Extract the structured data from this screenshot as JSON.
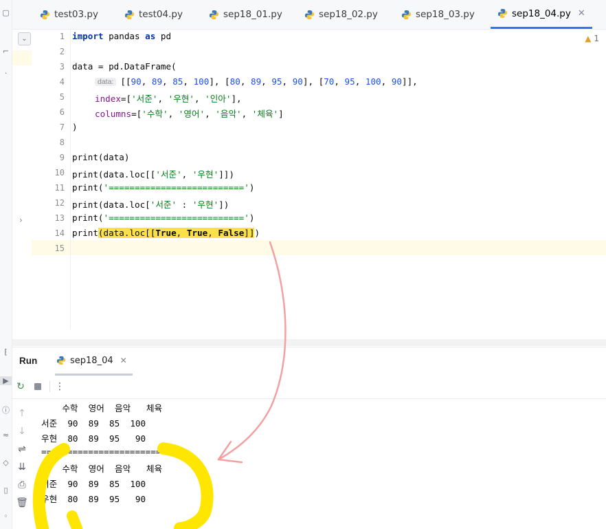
{
  "tabs": [
    {
      "label": "test03.py",
      "active": false
    },
    {
      "label": "test04.py",
      "active": false
    },
    {
      "label": "sep18_01.py",
      "active": false
    },
    {
      "label": "sep18_02.py",
      "active": false
    },
    {
      "label": "sep18_03.py",
      "active": false
    },
    {
      "label": "sep18_04.py",
      "active": true
    }
  ],
  "editor": {
    "warning_count": "1",
    "line_numbers": [
      "1",
      "2",
      "3",
      "4",
      "5",
      "6",
      "7",
      "8",
      "9",
      "10",
      "11",
      "12",
      "13",
      "14",
      "15"
    ],
    "inlay_hint": "data:",
    "code": {
      "l1_import": "import",
      "l1_mid": " pandas ",
      "l1_as": "as",
      "l1_end": " pd",
      "l3": "data = pd.DataFrame(",
      "l4_a": "[[",
      "l4_n1": "90",
      "l4_n2": "89",
      "l4_n3": "85",
      "l4_n4": "100",
      "l4_n5": "80",
      "l4_n6": "89",
      "l4_n7": "95",
      "l4_n8": "90",
      "l4_n9": "70",
      "l4_n10": "95",
      "l4_n11": "100",
      "l4_n12": "90",
      "l5_param": "index",
      "l5_s1": "'서준'",
      "l5_s2": "'우현'",
      "l5_s3": "'인아'",
      "l6_param": "columns",
      "l6_s1": "'수학'",
      "l6_s2": "'영어'",
      "l6_s3": "'음악'",
      "l6_s4": "'체육'",
      "l7": ")",
      "l9": "print(data)",
      "l10_a": "print(data.loc[[",
      "l10_s1": "'서준'",
      "l10_s2": "'우현'",
      "l10_b": "]])",
      "l11_a": "print(",
      "l11_s": "'=========================='",
      "l11_b": ")",
      "l12_a": "print(data.loc[",
      "l12_s1": "'서준'",
      "l12_mid": " : ",
      "l12_s2": "'우현'",
      "l12_b": "])",
      "l13_a": "print(",
      "l13_s": "'=========================='",
      "l13_b": ")",
      "l14_a": "print",
      "l14_h1": "(data.loc[[",
      "l14_t1": "True",
      "l14_t2": "True",
      "l14_t3": "False",
      "l14_h2": "]]",
      "l14_b": ")"
    }
  },
  "run_panel": {
    "title": "Run",
    "tab_label": "sep18_04",
    "output": [
      "    수학  영어  음악   체육",
      "서준  90  89  85  100",
      "우현  80  89  95   90",
      "==========================",
      "    수학  영어  음악   체육",
      "서준  90  89  85  100",
      "우현  80  89  95   90"
    ]
  },
  "colors": {
    "accent": "#3574f0",
    "highlight": "#fbe04a",
    "annotation_yellow": "#ffe600",
    "annotation_arrow": "#f08a8a"
  }
}
